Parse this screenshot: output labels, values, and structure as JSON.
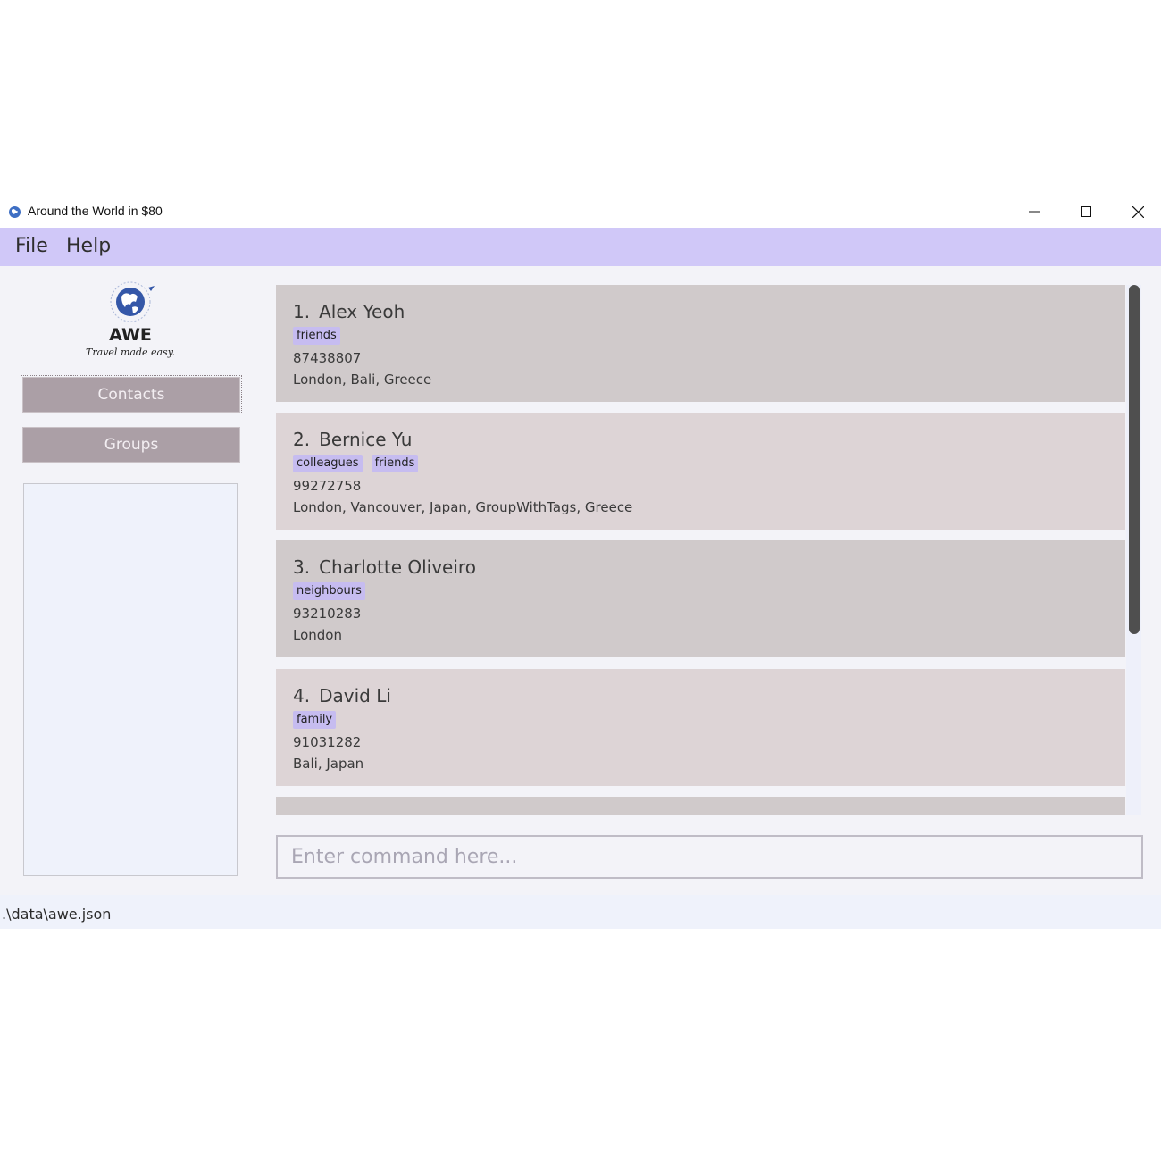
{
  "window": {
    "title": "Around the World in $80",
    "controls": [
      "minimize",
      "maximize",
      "close"
    ]
  },
  "menu": {
    "file": "File",
    "help": "Help"
  },
  "sidebar": {
    "logo_text": "AWE",
    "logo_tagline": "Travel made easy.",
    "contacts_button": "Contacts",
    "groups_button": "Groups"
  },
  "contacts": [
    {
      "index": "1.",
      "name": "Alex Yeoh",
      "tags": [
        "friends"
      ],
      "phone": "87438807",
      "places": "London, Bali, Greece"
    },
    {
      "index": "2.",
      "name": "Bernice Yu",
      "tags": [
        "colleagues",
        "friends"
      ],
      "phone": "99272758",
      "places": "London, Vancouver, Japan, GroupWithTags, Greece"
    },
    {
      "index": "3.",
      "name": "Charlotte Oliveiro",
      "tags": [
        "neighbours"
      ],
      "phone": "93210283",
      "places": "London"
    },
    {
      "index": "4.",
      "name": "David Li",
      "tags": [
        "family"
      ],
      "phone": "91031282",
      "places": "Bali, Japan"
    }
  ],
  "command": {
    "placeholder": "Enter command here..."
  },
  "status": {
    "path": ".\\data\\awe.json"
  },
  "colors": {
    "menubar": "#d0c8f8",
    "tag": "#c6bcf0",
    "card_odd": "#d0cacb",
    "card_even": "#ddd4d6",
    "nav_button": "#ab9fa6"
  }
}
